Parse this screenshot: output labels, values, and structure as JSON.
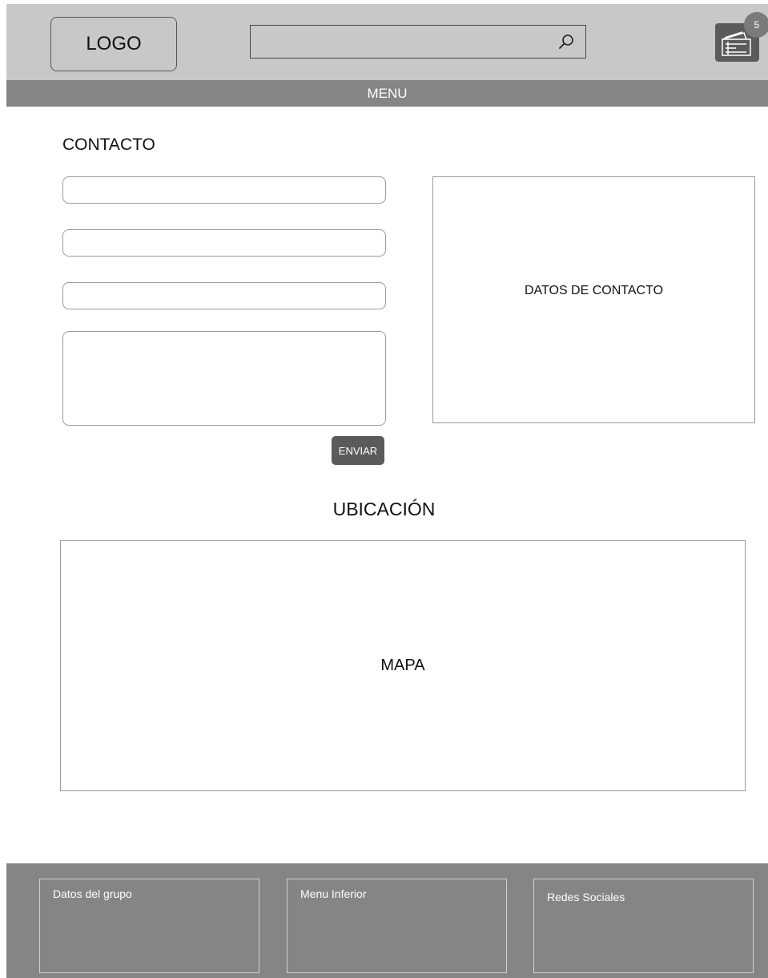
{
  "header": {
    "logo": "LOGO",
    "search": {
      "value": "",
      "placeholder": ""
    },
    "cart": {
      "icon": "shopping-cart-icon",
      "count": "5"
    }
  },
  "menu": {
    "label": "MENU"
  },
  "contact": {
    "title": "CONTACTO",
    "fields": [
      {
        "value": "",
        "placeholder": ""
      },
      {
        "value": "",
        "placeholder": ""
      },
      {
        "value": "",
        "placeholder": ""
      }
    ],
    "message": {
      "value": "",
      "placeholder": ""
    },
    "send_label": "ENVIAR",
    "info_label": "DATOS DE CONTACTO"
  },
  "location": {
    "title": "UBICACIÓN",
    "map_label": "MAPA"
  },
  "footer": {
    "boxes": [
      "Datos del grupo",
      "Menu Inferior",
      "Redes Sociales"
    ]
  },
  "colors": {
    "header_bg": "#c8c8c8",
    "menu_bg": "#858585",
    "button_bg": "#5b5b5b",
    "badge_bg": "#7a7a7a"
  }
}
